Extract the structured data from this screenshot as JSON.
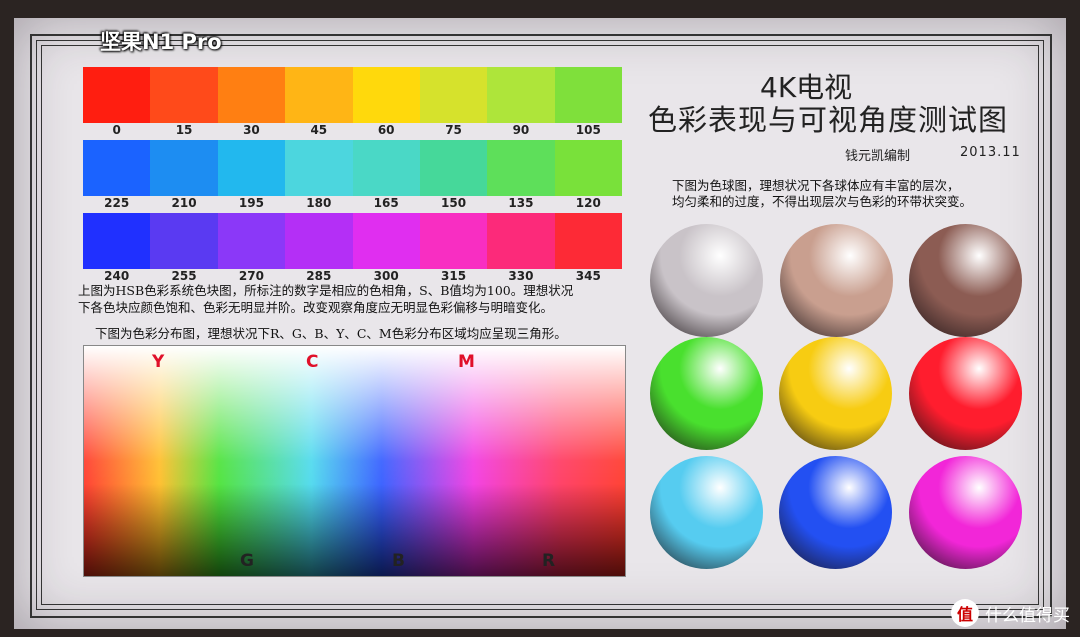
{
  "overlay": {
    "brand": "坚果N1 Pro"
  },
  "hue_rows": [
    {
      "colors": [
        "#ff1e10",
        "#ff4a1a",
        "#ff7f12",
        "#ffb515",
        "#ffd90c",
        "#d6e22c",
        "#aee53a",
        "#7fe03b"
      ],
      "labels": [
        "0",
        "15",
        "30",
        "45",
        "60",
        "75",
        "90",
        "105"
      ]
    },
    {
      "colors": [
        "#1b63ff",
        "#1d8df2",
        "#22b8ee",
        "#4cd6de",
        "#4ad8c6",
        "#46d89a",
        "#5edf5a",
        "#79e13a"
      ],
      "labels": [
        "225",
        "210",
        "195",
        "180",
        "165",
        "150",
        "135",
        "120"
      ]
    },
    {
      "colors": [
        "#2030ff",
        "#5a3af2",
        "#8b38f8",
        "#b42ff6",
        "#e02ef0",
        "#f82ec2",
        "#fc2a7a",
        "#fd2a36"
      ],
      "labels": [
        "240",
        "255",
        "270",
        "285",
        "300",
        "315",
        "330",
        "345"
      ]
    }
  ],
  "description": {
    "line1": "上图为HSB色彩系统色块图，所标注的数字是相应的色相角，S、B值均为100。理想状况",
    "line2": "下各色块应颜色饱和、色彩无明显并阶。改变观察角度应无明显色彩偏移与明暗变化。",
    "line3": "下图为色彩分布图，理想状况下R、G、B、Y、C、M色彩分布区域均应呈现三角形。"
  },
  "distribution": {
    "top_labels": [
      "Y",
      "C",
      "M"
    ],
    "bottom_labels": [
      "G",
      "B",
      "R"
    ],
    "label_colors": {
      "top": "#e0102a",
      "bottom": "#222222"
    }
  },
  "title": {
    "line1": "4K电视",
    "line2": "色彩表现与可视角度测试图",
    "author": "钱元凯编制",
    "date": "2013.11"
  },
  "sphere_description": {
    "line1": "下图为色球图，理想状况下各球体应有丰富的层次，",
    "line2": "均匀柔和的过度，不得出现层次与色彩的环带状突变。"
  },
  "spheres": [
    {
      "name": "gray",
      "color": "#c9c3c8"
    },
    {
      "name": "tan",
      "color": "#c99f8f"
    },
    {
      "name": "brown",
      "color": "#8c5c53"
    },
    {
      "name": "green",
      "color": "#49e02e"
    },
    {
      "name": "yellow",
      "color": "#f7cc12"
    },
    {
      "name": "red",
      "color": "#ff1d2e"
    },
    {
      "name": "cyan",
      "color": "#56ccf0"
    },
    {
      "name": "blue",
      "color": "#2350f2"
    },
    {
      "name": "magenta",
      "color": "#f226d8"
    }
  ],
  "watermark": {
    "icon": "值",
    "text": "什么值得买"
  }
}
